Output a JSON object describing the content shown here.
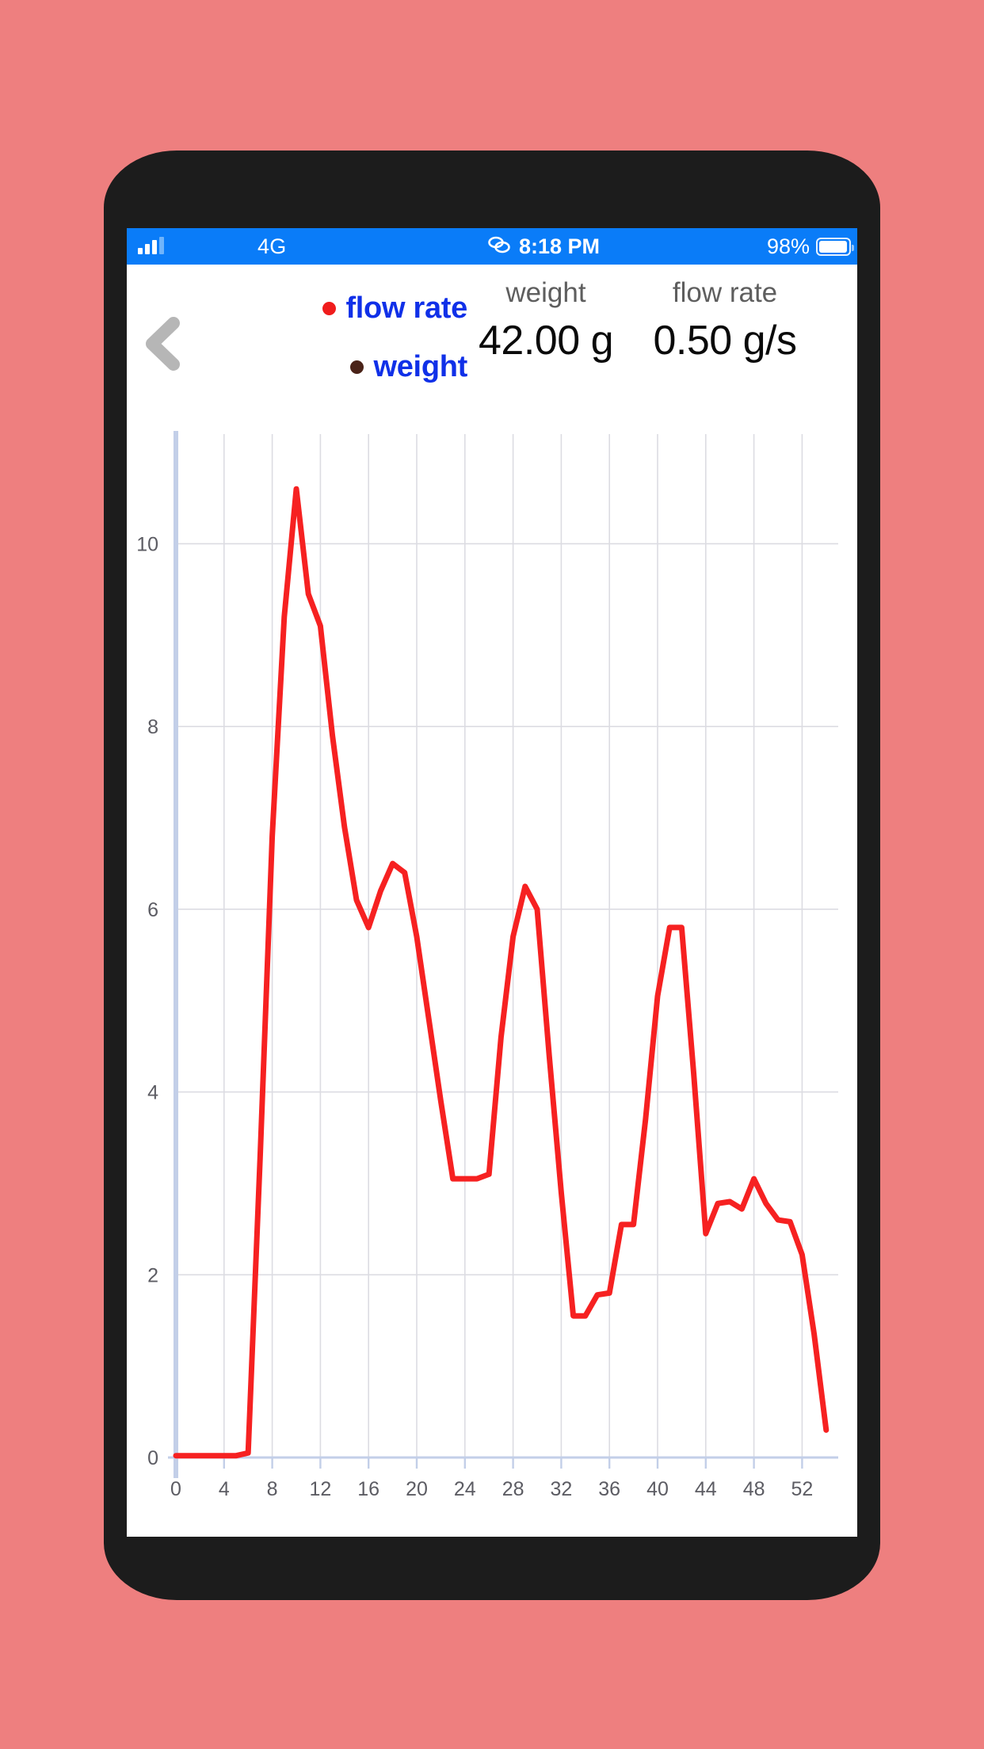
{
  "background_color": "#ee7f7f",
  "status_bar": {
    "signal_icon": "signal-bars-icon",
    "carrier": "4G",
    "link_icon": "link-chain-icon",
    "time": "8:18 PM",
    "battery_percent": "98%",
    "battery_icon": "battery-full-icon",
    "background_color": "#0a7cf8",
    "text_color": "#ffffff"
  },
  "header": {
    "back_icon": "back-chevron-icon",
    "legend": [
      {
        "label": "flow rate",
        "dot_color": "#f01c1c",
        "dot_name": "legend-dot-flow-rate"
      },
      {
        "label": "weight",
        "dot_color": "#4a2318",
        "dot_name": "legend-dot-weight"
      }
    ],
    "legend_text_color": "#1030e8",
    "stats": [
      {
        "label": "weight",
        "value": "42.00 g"
      },
      {
        "label": "flow rate",
        "value": "0.50 g/s"
      }
    ]
  },
  "chart_data": {
    "type": "line",
    "title": "",
    "xlabel": "",
    "ylabel": "",
    "xlim": [
      0,
      55
    ],
    "ylim": [
      0,
      11.2
    ],
    "grid": true,
    "legend_position": "top-left",
    "xticks": [
      0,
      4,
      8,
      12,
      16,
      20,
      24,
      28,
      32,
      36,
      40,
      44,
      48,
      52
    ],
    "yticks": [
      0,
      2,
      4,
      6,
      8,
      10
    ],
    "series": [
      {
        "name": "flow rate",
        "color": "#f62121",
        "units": "g/s",
        "x": [
          0,
          1,
          2,
          3,
          4,
          5,
          6,
          7,
          8,
          9,
          10,
          11,
          12,
          13,
          14,
          15,
          16,
          17,
          18,
          19,
          20,
          21,
          22,
          23,
          24,
          25,
          26,
          27,
          28,
          29,
          30,
          31,
          32,
          33,
          34,
          35,
          36,
          37,
          38,
          39,
          40,
          41,
          42,
          43,
          44,
          45,
          46,
          47,
          48,
          49,
          50,
          51,
          52,
          53,
          54
        ],
        "y": [
          0.02,
          0.02,
          0.02,
          0.02,
          0.02,
          0.02,
          0.05,
          3.3,
          6.8,
          9.2,
          10.6,
          9.45,
          9.1,
          7.9,
          6.9,
          6.1,
          5.8,
          6.2,
          6.5,
          6.4,
          5.7,
          4.8,
          3.9,
          3.05,
          3.05,
          3.05,
          3.1,
          4.6,
          5.7,
          6.25,
          6.0,
          4.4,
          2.9,
          1.55,
          1.55,
          1.78,
          1.8,
          2.55,
          2.55,
          3.7,
          5.05,
          5.8,
          5.8,
          4.2,
          2.45,
          2.78,
          2.8,
          2.72,
          3.05,
          2.78,
          2.6,
          2.58,
          2.22,
          1.35,
          0.3
        ]
      }
    ]
  }
}
